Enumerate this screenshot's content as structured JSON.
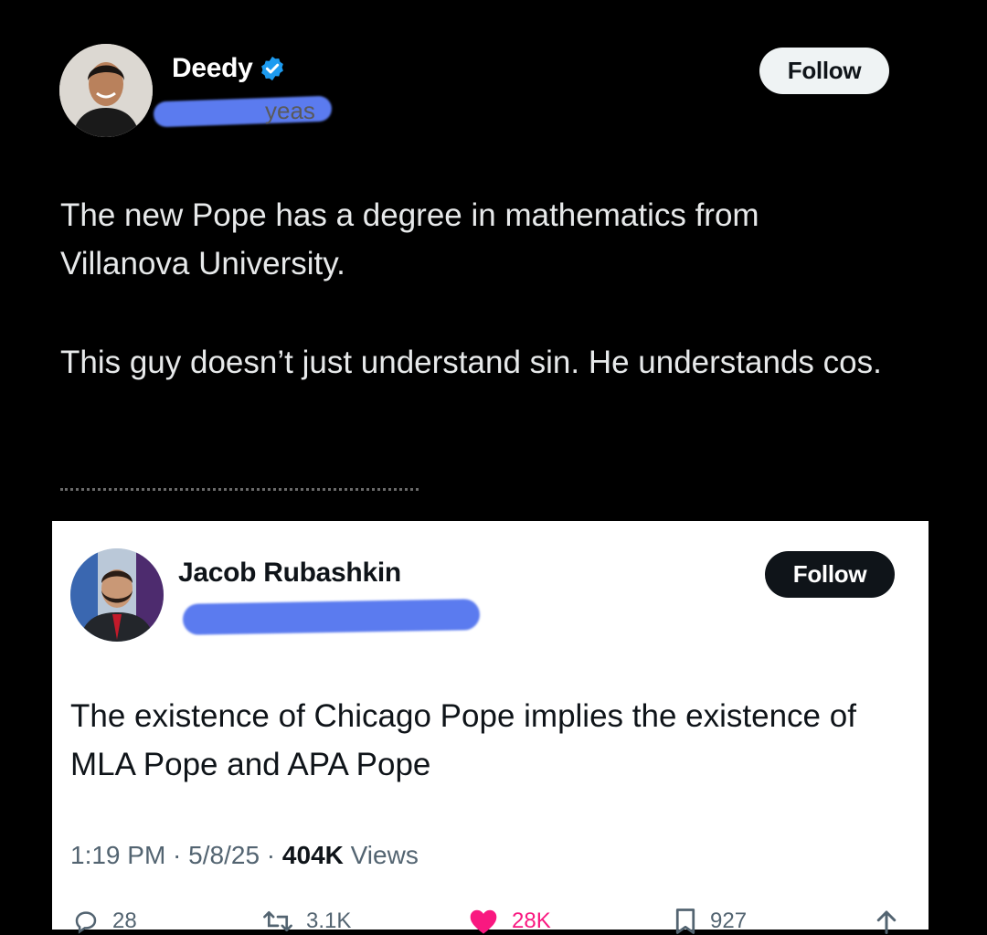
{
  "top_tweet": {
    "author": {
      "display_name": "Deedy",
      "handle_visible_fragment": "yeas"
    },
    "follow_label": "Follow",
    "paragraphs": [
      "The new Pope has a degree in mathematics from Villanova University.",
      "This guy doesn’t just understand sin. He understands cos."
    ]
  },
  "quoted_tweet": {
    "author": {
      "display_name": "Jacob Rubashkin"
    },
    "follow_label": "Follow",
    "text": "The existence of Chicago Pope implies the existence of MLA Pope and APA Pope",
    "meta": {
      "time": "1:19 PM",
      "date": "5/8/25",
      "views_count": "404K",
      "views_label": "Views",
      "separator": " · "
    },
    "actions": {
      "replies": "28",
      "reposts": "3.1K",
      "likes": "28K",
      "bookmarks": "927"
    }
  },
  "colors": {
    "verified": "#1d9bf0",
    "like": "#f91880",
    "redaction": "#5b7bef"
  },
  "icons": [
    "verified-badge-icon",
    "reply-icon",
    "repost-icon",
    "like-icon",
    "bookmark-icon",
    "share-icon"
  ]
}
